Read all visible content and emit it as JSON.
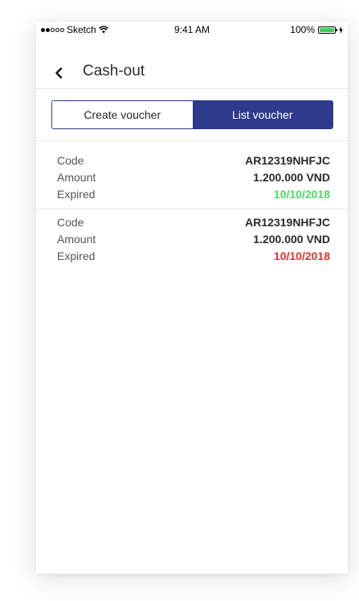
{
  "status_bar": {
    "carrier": "Sketch",
    "time": "9:41 AM",
    "battery": "100%",
    "signal_bars_filled": 2,
    "signal_bars_total": 5
  },
  "nav": {
    "title": "Cash-out"
  },
  "tabs": [
    {
      "label": "Create voucher",
      "active": false
    },
    {
      "label": "List voucher",
      "active": true
    }
  ],
  "vouchers": [
    {
      "code_label": "Code",
      "code": "AR12319NHFJC",
      "amount_label": "Amount",
      "amount": "1.200.000 VND",
      "expired_label": "Expired",
      "expired": "10/10/2018",
      "expired_color": "#4cd964"
    },
    {
      "code_label": "Code",
      "code": "AR12319NHFJC",
      "amount_label": "Amount",
      "amount": "1.200.000 VND",
      "expired_label": "Expired",
      "expired": "10/10/2018",
      "expired_color": "#e0332f"
    }
  ],
  "colors": {
    "accent": "#2e3a8c",
    "battery": "#39d353"
  },
  "icons": {
    "back": "chevron-left-icon",
    "wifi": "wifi-icon",
    "battery": "battery-icon",
    "charging": "bolt-icon"
  }
}
